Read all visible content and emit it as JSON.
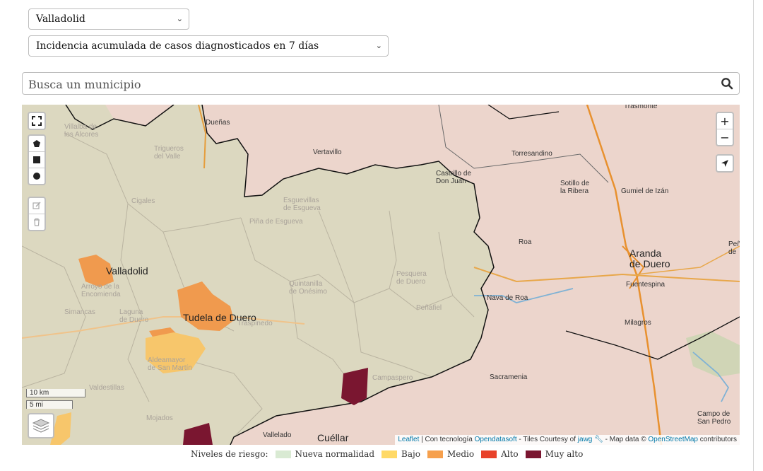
{
  "filters": {
    "province": "Valladolid",
    "metric": "Incidencia acumulada de casos diagnosticados en 7 días"
  },
  "search": {
    "placeholder": "Busca un municipio",
    "value": ""
  },
  "map": {
    "places": [
      {
        "name": "Dueñas"
      },
      {
        "name": "Vertavillo"
      },
      {
        "name": "Torresandino"
      },
      {
        "name": "Castrillo de\nDon Juan"
      },
      {
        "name": "Sotillo de\nla Ribera"
      },
      {
        "name": "Gumiel de Izán"
      },
      {
        "name": "Trasmonte"
      },
      {
        "name": "Roa"
      },
      {
        "name": "Aranda\nde Duero"
      },
      {
        "name": "Fuentespina"
      },
      {
        "name": "Nava de Roa"
      },
      {
        "name": "Milagros"
      },
      {
        "name": "Sacramenia"
      },
      {
        "name": "Campo de\nSan Pedro"
      },
      {
        "name": "Vallelado"
      },
      {
        "name": "Cuéllar"
      },
      {
        "name": "Valladolid"
      },
      {
        "name": "Arroyo de la\nEncomienda"
      },
      {
        "name": "Laguna\nde Duero"
      },
      {
        "name": "Tudela de Duero"
      },
      {
        "name": "Traspinedo"
      },
      {
        "name": "Aldeamayor\nde San Martín"
      },
      {
        "name": "Cigales"
      },
      {
        "name": "Esguevillas\nde Esgueva"
      },
      {
        "name": "Piña de Esgueva"
      },
      {
        "name": "Quintanilla\nde Onésimo"
      },
      {
        "name": "Pesquera\nde Duero"
      },
      {
        "name": "Peñafiel"
      },
      {
        "name": "Campaspero"
      },
      {
        "name": "Valdestillas"
      },
      {
        "name": "Mojados"
      },
      {
        "name": "Simancas"
      },
      {
        "name": "Villalba de\nlos Alcores"
      },
      {
        "name": "Trigueros\ndel Valle"
      },
      {
        "name": "Peñ\nde"
      }
    ],
    "scale": {
      "km": "10 km",
      "mi": "5 mi"
    },
    "attribution": {
      "leaflet": "Leaflet",
      "powered_prefix": "| Con tecnología",
      "provider": "Opendatasoft",
      "tiles_prefix": "- Tiles Courtesy of",
      "tiles_provider": "jawg",
      "data_prefix": "- Map data ©",
      "osm": "OpenStreetMap",
      "data_suffix": "contributors"
    },
    "zoom_in_label": "+",
    "zoom_out_label": "−",
    "colors": {
      "nueva_normalidad": "#d9d9b8",
      "bajo": "#f7c66b",
      "medio": "#f0954a",
      "alto": "#e8422a",
      "muy_alto": "#7a1630",
      "outside": "#ecd5cc"
    }
  },
  "legend": {
    "title": "Niveles de riesgo:",
    "items": [
      {
        "label": "Nueva normalidad",
        "color": "#d9ead3"
      },
      {
        "label": "Bajo",
        "color": "#ffd966"
      },
      {
        "label": "Medio",
        "color": "#f6a04d"
      },
      {
        "label": "Alto",
        "color": "#e8422a"
      },
      {
        "label": "Muy alto",
        "color": "#7a1630"
      }
    ]
  }
}
